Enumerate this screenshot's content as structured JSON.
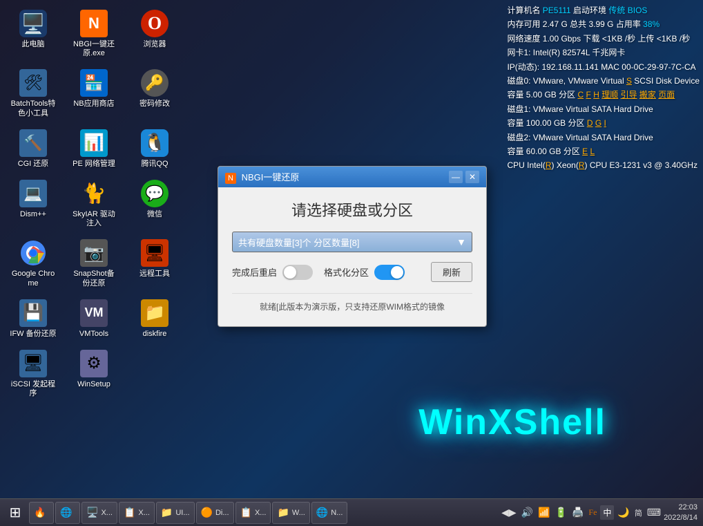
{
  "desktop": {
    "background": "#1a1a2e"
  },
  "icons": [
    {
      "id": "this-pc",
      "label": "此电脑",
      "emoji": "🖥️",
      "color": "#4a9ade"
    },
    {
      "id": "nbgi-restore",
      "label": "NBGI一键还原.exe",
      "emoji": "🔧",
      "color": "#ff6600"
    },
    {
      "id": "browser",
      "label": "浏览器",
      "emoji": "🌐",
      "color": "#cc2200"
    },
    {
      "id": "batchtools",
      "label": "BatchTools特色小工具",
      "emoji": "🛠️",
      "color": "#336699"
    },
    {
      "id": "nb-app-store",
      "label": "NB应用商店",
      "emoji": "🏪",
      "color": "#0066cc"
    },
    {
      "id": "password-change",
      "label": "密码修改",
      "emoji": "🔑",
      "color": "#666666"
    },
    {
      "id": "cgi-restore",
      "label": "CGI 还原",
      "emoji": "🔨",
      "color": "#336699"
    },
    {
      "id": "pe-network",
      "label": "PE 网络管理",
      "emoji": "📊",
      "color": "#0099cc"
    },
    {
      "id": "tencent-qq",
      "label": "腾讯QQ",
      "emoji": "🐧",
      "color": "#1a88d8"
    },
    {
      "id": "dism-plus",
      "label": "Dism++",
      "emoji": "💻",
      "color": "#336699"
    },
    {
      "id": "skyiar-driver",
      "label": "SkyIAR 驱动注入",
      "emoji": "🐕",
      "color": "#8B4513"
    },
    {
      "id": "wechat",
      "label": "微信",
      "emoji": "💬",
      "color": "#1aad19"
    },
    {
      "id": "google-chrome",
      "label": "Google Chrome",
      "emoji": "🌐",
      "color": "#4285f4"
    },
    {
      "id": "snapshot-restore",
      "label": "SnapShot备份还原",
      "emoji": "📷",
      "color": "#666666"
    },
    {
      "id": "remote-tools",
      "label": "远程工具",
      "emoji": "🖥️",
      "color": "#cc3300"
    },
    {
      "id": "ifw-backup",
      "label": "IFW 备份还原",
      "emoji": "💾",
      "color": "#336699"
    },
    {
      "id": "vmtools",
      "label": "VMTools",
      "emoji": "🖥️",
      "color": "#666699"
    },
    {
      "id": "diskfire",
      "label": "diskfire",
      "emoji": "📁",
      "color": "#cc8800"
    },
    {
      "id": "iscsi",
      "label": "iSCSI 发起程序",
      "emoji": "💻",
      "color": "#336699"
    },
    {
      "id": "winsetup",
      "label": "WinSetup",
      "emoji": "🔧",
      "color": "#666699"
    }
  ],
  "sysinfo": {
    "lines": [
      "计算机名 PE5111  启动环境 传统 BIOS",
      "内存可用 2.47 G  总共 3.99 G  占用率 38%",
      "网络速度 1.00 Gbps 下载 <1KB /秒 上传 <1KB /秒",
      "网卡1: Intel(R) 82574L 千兆网卡",
      "IP(动态): 192.168.11.141 MAC 00-0C-29-97-7C-CA",
      "磁盘0: VMware, VMware Virtual S SCSI Disk Device",
      "容量 5.00 GB 分区 C F H  理顺 引导 搬家 页面",
      "磁盘1: VMware Virtual SATA Hard Drive",
      "容量 100.00 GB 分区 D G I",
      "磁盘2: VMware Virtual SATA Hard Drive",
      "容量 60.00 GB 分区 E L",
      "CPU Intel(R) Xeon(R) CPU E3-1231 v3 @ 3.40GHz"
    ]
  },
  "dialog": {
    "title": "NBGI一键还原",
    "heading": "请选择硬盘或分区",
    "dropdown_text": "共有硬盘数量[3]个  分区数量[8]",
    "option1_label": "完成后重启",
    "option1_state": "off",
    "option2_label": "格式化分区",
    "option2_state": "on",
    "refresh_btn": "刷新",
    "footer_text": "就绪[此版本为演示版，只支持还原WIM格式的镜像",
    "minimize_label": "—",
    "close_label": "✕"
  },
  "winxshell": {
    "text": "WinXShell"
  },
  "taskbar": {
    "start_icon": "⊞",
    "buttons": [
      {
        "id": "tb1",
        "icon": "🔥",
        "label": ""
      },
      {
        "id": "tb2",
        "icon": "🌐",
        "label": ""
      },
      {
        "id": "tb3",
        "icon": "🖥️",
        "label": "X..."
      },
      {
        "id": "tb4",
        "icon": "📋",
        "label": "X..."
      },
      {
        "id": "tb5",
        "icon": "📁",
        "label": "UI..."
      },
      {
        "id": "tb6",
        "icon": "🟠",
        "label": "Di..."
      },
      {
        "id": "tb7",
        "icon": "📋",
        "label": "X..."
      },
      {
        "id": "tb8",
        "icon": "📁",
        "label": "W..."
      },
      {
        "id": "tb9",
        "icon": "🌐",
        "label": "N..."
      }
    ],
    "tray": {
      "lang": "中",
      "icons": [
        "◀▶",
        "🔊",
        "🔵",
        "📶",
        "🖨️",
        "Fe",
        "中",
        "▦"
      ],
      "time": "22:03",
      "date": "2022/8/14"
    }
  }
}
